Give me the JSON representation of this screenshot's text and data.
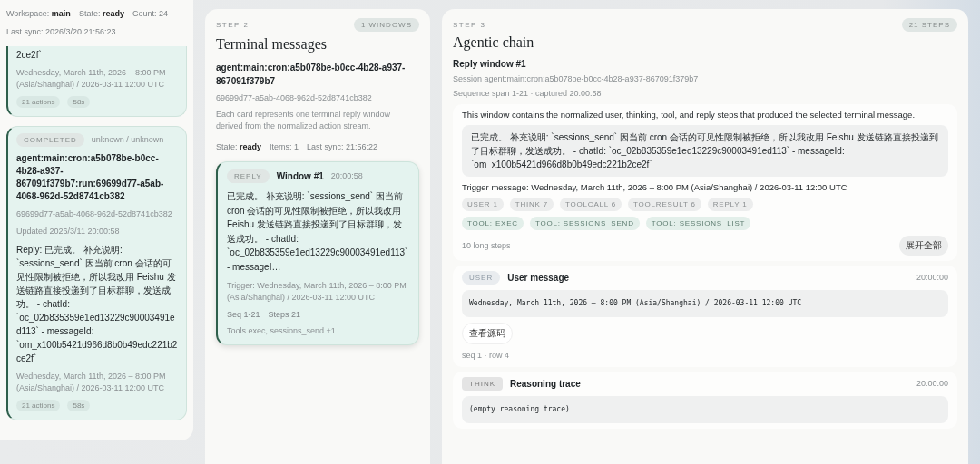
{
  "runs_panel": {
    "workspace_label": "Workspace:",
    "workspace": "main",
    "state_label": "State:",
    "state": "ready",
    "count": "Count: 24",
    "last_sync": "Last sync: 2026/3/20 21:56:23",
    "runs": [
      {
        "reply": "2ce2f`",
        "date": "Wednesday, March 11th, 2026 – 8:00 PM (Asia/Shanghai) / 2026-03-11 12:00 UTC",
        "chips": [
          "21 actions",
          "58s"
        ]
      },
      {
        "status": "COMPLETED",
        "source": "unknown / unknown",
        "title": "agent:main:cron:a5b078be-b0cc-4b28-a937-867091f379b7:run:69699d77-a5ab-4068-962d-52d8741cb382",
        "id": "69699d77-a5ab-4068-962d-52d8741cb382",
        "updated": "Updated 2026/3/11 20:00:58",
        "reply": "Reply: 已完成。 补充说明: `sessions_send` 因当前 cron 会话的可见性限制被拒绝，所以我改用 Feishu 发送链路直接投递到了目标群聊，发送成功。 - chatId: `oc_02b835359e1ed13229c90003491ed113` - messageId: `om_x100b5421d966d8b0b49edc221b2ce2f`",
        "date": "Wednesday, March 11th, 2026 – 8:00 PM (Asia/Shanghai) / 2026-03-11 12:00 UTC",
        "chips": [
          "21 actions",
          "58s"
        ]
      }
    ]
  },
  "terminal_panel": {
    "step": "STEP 2",
    "badge": "1 WINDOWS",
    "title": "Terminal messages",
    "session": "agent:main:cron:a5b078be-b0cc-4b28-a937-867091f379b7",
    "run_id": "69699d77-a5ab-4068-962d-52d8741cb382",
    "description": "Each card represents one terminal reply window derived from the normalized action stream.",
    "state_label": "State:",
    "state": "ready",
    "items": "Items: 1",
    "last_sync": "Last sync: 21:56:22",
    "windows": [
      {
        "kind_label": "REPLY",
        "title": "Window #1",
        "time": "20:00:58",
        "selected": true,
        "text": "已完成。 补充说明: `sessions_send` 因当前 cron 会话的可见性限制被拒绝，所以我改用 Feishu 发送链路直接投递到了目标群聊，发送成功。 - chatId: `oc_02b835359e1ed13229c90003491ed113` - messageI…",
        "trigger": "Trigger: Wednesday, March 11th, 2026 – 8:00 PM (Asia/Shanghai) / 2026-03-11 12:00 UTC",
        "seq": "Seq 1-21",
        "steps": "Steps 21",
        "tools": "Tools exec, sessions_send +1"
      }
    ]
  },
  "chain_panel": {
    "step": "STEP 3",
    "badge": "21 STEPS",
    "title": "Agentic chain",
    "window_title": "Reply window #1",
    "session": "Session agent:main:cron:a5b078be-b0cc-4b28-a937-867091f379b7",
    "span": "Sequence span 1-21 · captured 20:00:58",
    "summary": {
      "description": "This window contains the normalized user, thinking, tool, and reply steps that produced the selected terminal message.",
      "reply": "已完成。 补充说明: `sessions_send` 因当前 cron 会话的可见性限制被拒绝，所以我改用 Feishu 发送链路直接投递到了目标群聊，发送成功。 - chatId: `oc_02b835359e1ed13229c90003491ed113` - messageId: `om_x100b5421d966d8b0b49edc221b2ce2f`",
      "trigger": "Trigger message: Wednesday, March 11th, 2026 – 8:00 PM (Asia/Shanghai) / 2026-03-11 12:00 UTC",
      "tags": [
        {
          "label": "USER 1",
          "kind": "count"
        },
        {
          "label": "THINK 7",
          "kind": "count"
        },
        {
          "label": "TOOLCALL 6",
          "kind": "count"
        },
        {
          "label": "TOOLRESULT 6",
          "kind": "count"
        },
        {
          "label": "REPLY 1",
          "kind": "count"
        },
        {
          "label": "TOOL: EXEC",
          "kind": "tool"
        },
        {
          "label": "TOOL: SESSIONS_SEND",
          "kind": "tool"
        },
        {
          "label": "TOOL: SESSIONS_LIST",
          "kind": "tool"
        }
      ],
      "long_steps": "10 long steps",
      "expand_button": "展开全部"
    },
    "steps": [
      {
        "kind": "user",
        "kind_label": "USER",
        "title": "User message",
        "time": "20:00:00",
        "content": "Wednesday, March 11th, 2026 – 8:00 PM (Asia/Shanghai) / 2026-03-11 12:00 UTC",
        "source_button": "查看源码",
        "meta": "seq 1 · row 4"
      },
      {
        "kind": "think",
        "kind_label": "THINK",
        "title": "Reasoning trace",
        "time": "20:00:00",
        "content": "(empty reasoning trace)"
      }
    ]
  }
}
